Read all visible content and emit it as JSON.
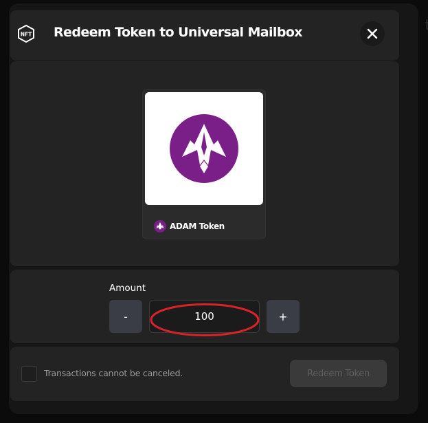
{
  "dialog": {
    "title": "Redeem Token to Universal Mailbox",
    "icon": "nft-hexagon-icon",
    "icon_text": "NFT",
    "close_icon": "close-icon"
  },
  "token": {
    "name": "ADAM Token",
    "logo": "adam-token-logo",
    "logo_color": "#7b1f88"
  },
  "amount": {
    "label": "Amount",
    "value": "100",
    "decrement_label": "-",
    "increment_label": "+"
  },
  "footer": {
    "checkbox_checked": false,
    "checkbox_label": "Transactions cannot be canceled.",
    "redeem_label": "Redeem Token",
    "redeem_enabled": false
  },
  "annotation": {
    "color": "#d9232a",
    "shape": "ellipse"
  }
}
